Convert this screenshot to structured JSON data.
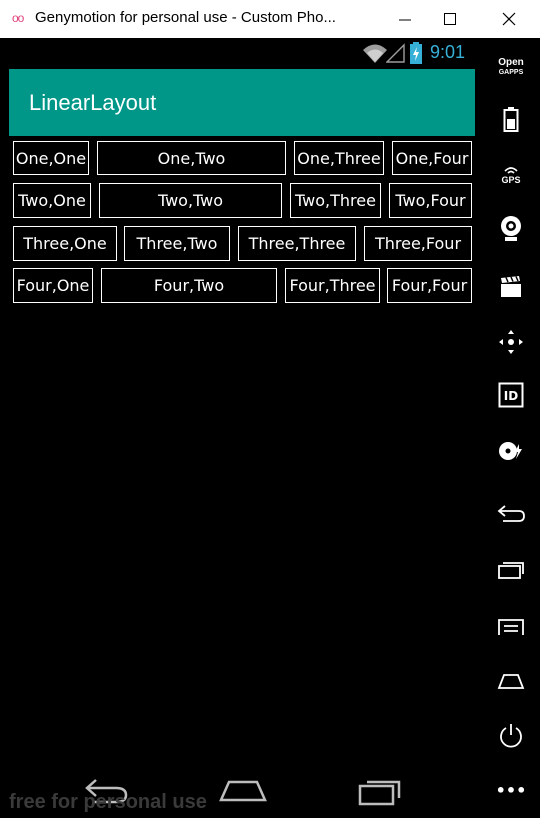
{
  "window": {
    "logo": "oo",
    "title": "Genymotion for personal use - Custom Pho..."
  },
  "status": {
    "time": "9:01"
  },
  "app": {
    "title": "LinearLayout"
  },
  "grid": {
    "rows": [
      [
        "One,One",
        "One,Two",
        "One,Three",
        "One,Four"
      ],
      [
        "Two,One",
        "Two,Two",
        "Two,Three",
        "Two,Four"
      ],
      [
        "Three,One",
        "Three,Two",
        "Three,Three",
        "Three,Four"
      ],
      [
        "Four,One",
        "Four,Two",
        "Four,Three",
        "Four,Four"
      ]
    ]
  },
  "sidebar": {
    "opengapps_line1": "Open",
    "opengapps_line2": "GAPPS",
    "gps_label": "GPS",
    "id_label": "ID",
    "more_label": "•••"
  },
  "watermark": "free for personal use",
  "colors": {
    "accent": "#009688",
    "status_clock": "#37b0d8"
  }
}
